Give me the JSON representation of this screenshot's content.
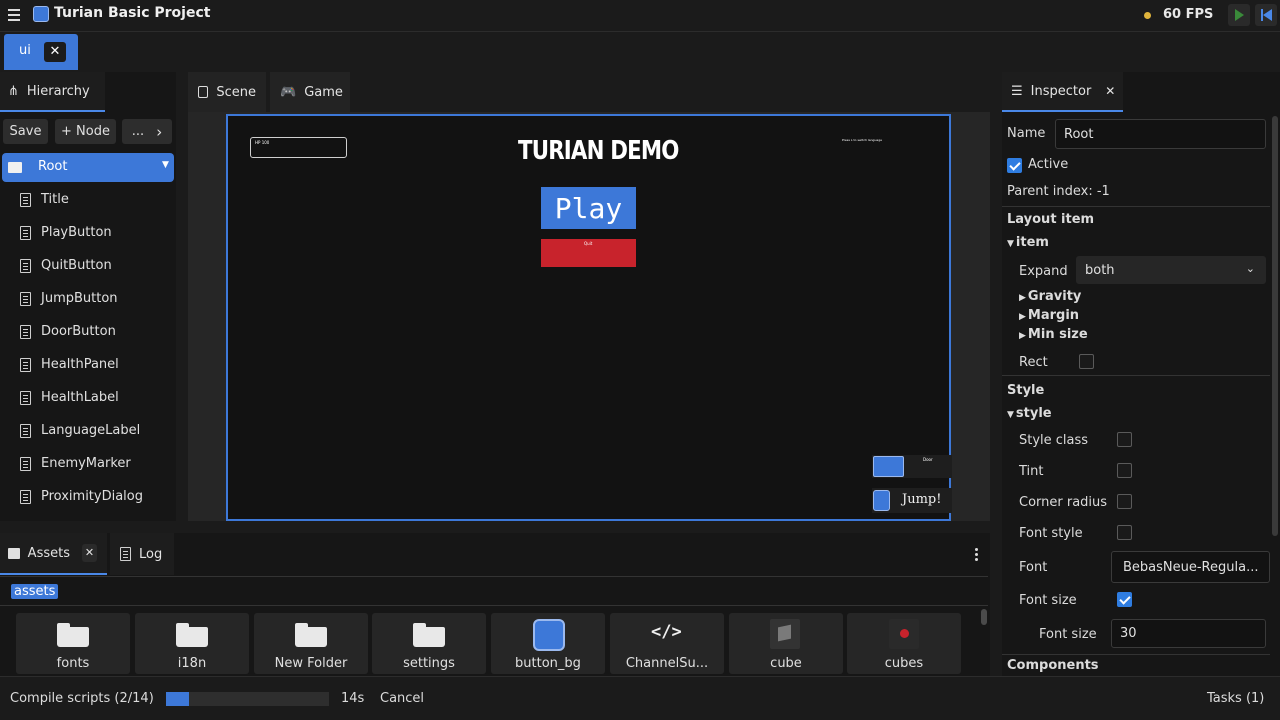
{
  "app": {
    "title": "Turian Basic Project",
    "fps": "60 FPS",
    "open_tab": "ui"
  },
  "hierarchy": {
    "tab_label": "Hierarchy",
    "save": "Save",
    "add_node": "+ Node",
    "more": "...",
    "more_arrow": "›",
    "root": "Root",
    "items": [
      "Title",
      "PlayButton",
      "QuitButton",
      "JumpButton",
      "DoorButton",
      "HealthPanel",
      "HealthLabel",
      "LanguageLabel",
      "EnemyMarker",
      "ProximityDialog"
    ]
  },
  "viewport": {
    "tabs": [
      "Scene",
      "Game"
    ],
    "hp_text": "HP 100",
    "title": "TURIAN DEMO",
    "play": "Play",
    "quit": "Quit",
    "lang_text": "Press L to switch language",
    "door_text": "Door",
    "jump": "Jump!"
  },
  "inspector": {
    "tab_label": "Inspector",
    "name_label": "Name",
    "name_value": "Root",
    "active_label": "Active",
    "parent_index": "Parent index: -1",
    "layout_item": "Layout item",
    "item": "item",
    "expand_label": "Expand",
    "expand_value": "both",
    "gravity": "Gravity",
    "margin": "Margin",
    "min_size": "Min size",
    "rect": "Rect",
    "style": "Style",
    "style_sub": "style",
    "style_class": "Style class",
    "tint": "Tint",
    "corner_radius": "Corner radius",
    "font_style": "Font style",
    "font_label": "Font",
    "font_value": "BebasNeue-Regula...",
    "font_size_label": "Font size",
    "font_size_value": "30",
    "components": "Components"
  },
  "assets": {
    "tab_label": "Assets",
    "log_label": "Log",
    "path": "assets",
    "items": [
      "fonts",
      "i18n",
      "New Folder",
      "settings",
      "button_bg",
      "ChannelSu...",
      "cube",
      "cubes"
    ]
  },
  "status": {
    "task": "Compile scripts (2/14)",
    "progress": 0.14,
    "time": "14s",
    "cancel": "Cancel",
    "tasks": "Tasks (1)"
  },
  "colors": {
    "accent": "#3d78d8",
    "quit_red": "#c8232c",
    "fps_dot": "#e0b43c"
  }
}
